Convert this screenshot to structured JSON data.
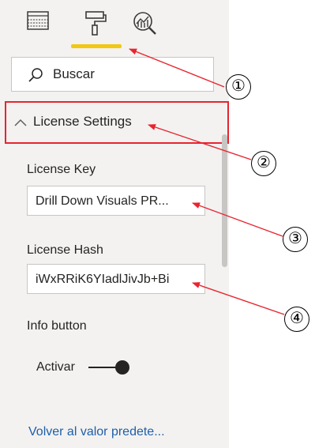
{
  "tabs": [
    {
      "name": "fields",
      "icon": "table-fields-icon",
      "active": false
    },
    {
      "name": "format",
      "icon": "paint-roller-icon",
      "active": true
    },
    {
      "name": "analytics",
      "icon": "analytics-magnifier-icon",
      "active": false
    }
  ],
  "search": {
    "placeholder": "Buscar"
  },
  "section": {
    "title": "License Settings",
    "expanded": true
  },
  "fields": {
    "license_key": {
      "label": "License Key",
      "value": "Drill Down Visuals PR..."
    },
    "license_hash": {
      "label": "License Hash",
      "value": "iWxRRiK6YIadlJivJb+Bi"
    }
  },
  "info_button": {
    "label": "Info button",
    "toggle_label": "Activar",
    "on": true
  },
  "reset_link": "Volver al valor predete...",
  "annotations": [
    "①",
    "②",
    "③",
    "④"
  ],
  "colors": {
    "panel_bg": "#f3f2f1",
    "accent_underline": "#f2c811",
    "highlight_box": "#e8242e",
    "arrow": "#e8242e",
    "link": "#1f5fa8"
  }
}
